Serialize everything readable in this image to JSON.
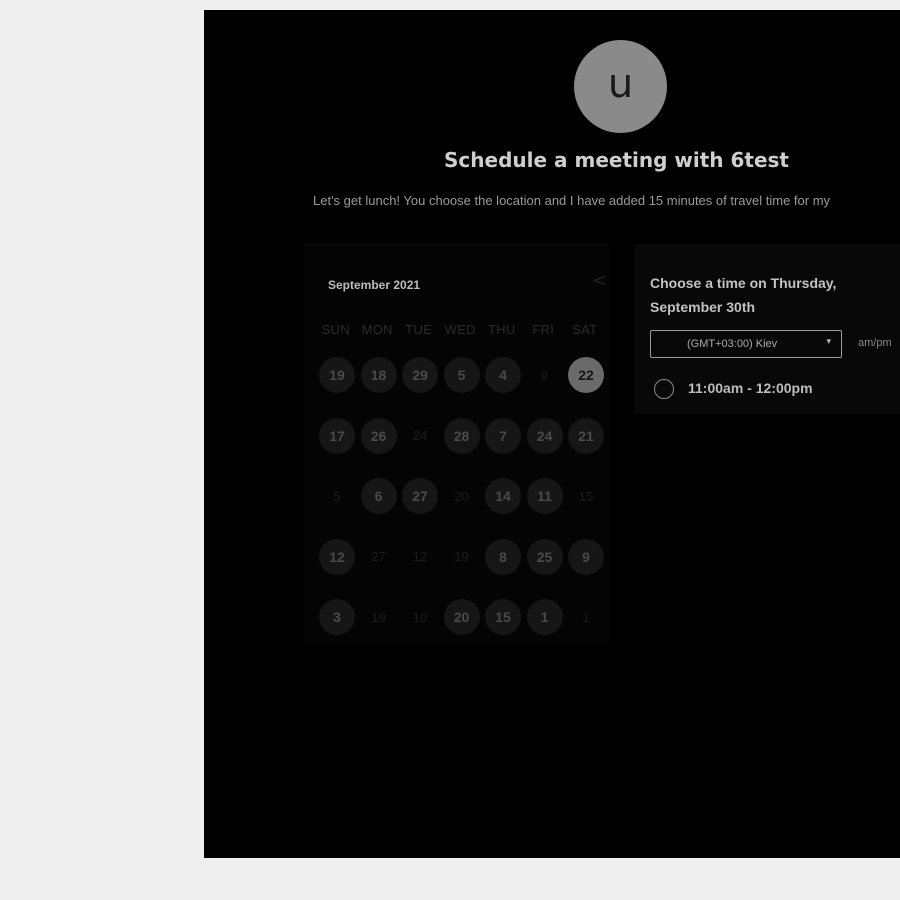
{
  "host": {
    "avatar_initial": "u",
    "title": "Schedule a meeting with 6test",
    "description": "Let's get lunch! You choose the location and I have added 15 minutes of travel time for my"
  },
  "calendar": {
    "month_label": "September 2021",
    "prev_icon": "chevron-left-icon",
    "next_icon": "chevron-right-icon",
    "prev_glyph": "<",
    "next_glyph": ">",
    "weekdays": [
      "SUN",
      "MON",
      "TUE",
      "WED",
      "THU",
      "FRI",
      "SAT"
    ],
    "weeks": [
      [
        {
          "label": "19",
          "state": "available"
        },
        {
          "label": "18",
          "state": "available"
        },
        {
          "label": "29",
          "state": "available"
        },
        {
          "label": "5",
          "state": "available"
        },
        {
          "label": "4",
          "state": "available"
        },
        {
          "label": "9",
          "state": "unavailable"
        },
        {
          "label": "22",
          "state": "selected"
        }
      ],
      [
        {
          "label": "17",
          "state": "available"
        },
        {
          "label": "26",
          "state": "available"
        },
        {
          "label": "24",
          "state": "unavailable"
        },
        {
          "label": "28",
          "state": "available"
        },
        {
          "label": "7",
          "state": "available"
        },
        {
          "label": "24",
          "state": "available"
        },
        {
          "label": "21",
          "state": "available"
        }
      ],
      [
        {
          "label": "5",
          "state": "unavailable"
        },
        {
          "label": "6",
          "state": "available"
        },
        {
          "label": "27",
          "state": "available"
        },
        {
          "label": "20",
          "state": "unavailable"
        },
        {
          "label": "14",
          "state": "available"
        },
        {
          "label": "11",
          "state": "available"
        },
        {
          "label": "15",
          "state": "unavailable"
        }
      ],
      [
        {
          "label": "12",
          "state": "available"
        },
        {
          "label": "27",
          "state": "unavailable"
        },
        {
          "label": "12",
          "state": "unavailable"
        },
        {
          "label": "19",
          "state": "unavailable"
        },
        {
          "label": "8",
          "state": "available"
        },
        {
          "label": "25",
          "state": "available"
        },
        {
          "label": "9",
          "state": "available"
        }
      ],
      [
        {
          "label": "3",
          "state": "available"
        },
        {
          "label": "19",
          "state": "unavailable"
        },
        {
          "label": "10",
          "state": "unavailable"
        },
        {
          "label": "20",
          "state": "available"
        },
        {
          "label": "15",
          "state": "available"
        },
        {
          "label": "1",
          "state": "available"
        },
        {
          "label": "1",
          "state": "unavailable"
        }
      ]
    ]
  },
  "time_picker": {
    "heading": "Choose a time on Thursday, September 30th",
    "timezone": "(GMT+03:00) Kiev",
    "timezone_caret": "▾",
    "format_label": "am/pm",
    "slots": [
      {
        "label": "11:00am - 12:00pm"
      }
    ]
  },
  "colors": {
    "page_background": "#efefef",
    "panel_background": "#000000",
    "selected_day": "#6a6a6a",
    "avatar": "#8a8a8a"
  }
}
